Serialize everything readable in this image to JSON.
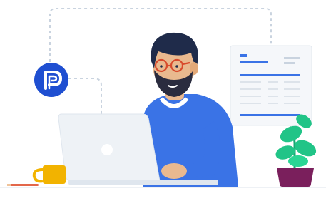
{
  "scene": {
    "brand_badge_icon": "p-logo-icon",
    "colors": {
      "badge": "#1f4fd1",
      "shirt": "#3a73e6",
      "hair": "#1f2b4a",
      "skin": "#e9b98f",
      "beard": "#2a2c3f",
      "glasses": "#d84a2c",
      "mug": "#f2b300",
      "plant_leaf": "#21c487",
      "pot": "#7a1f5c",
      "laptop": "#eef2f6",
      "document_accent": "#3a73e6",
      "dotted_path": "#c9d3df"
    }
  }
}
